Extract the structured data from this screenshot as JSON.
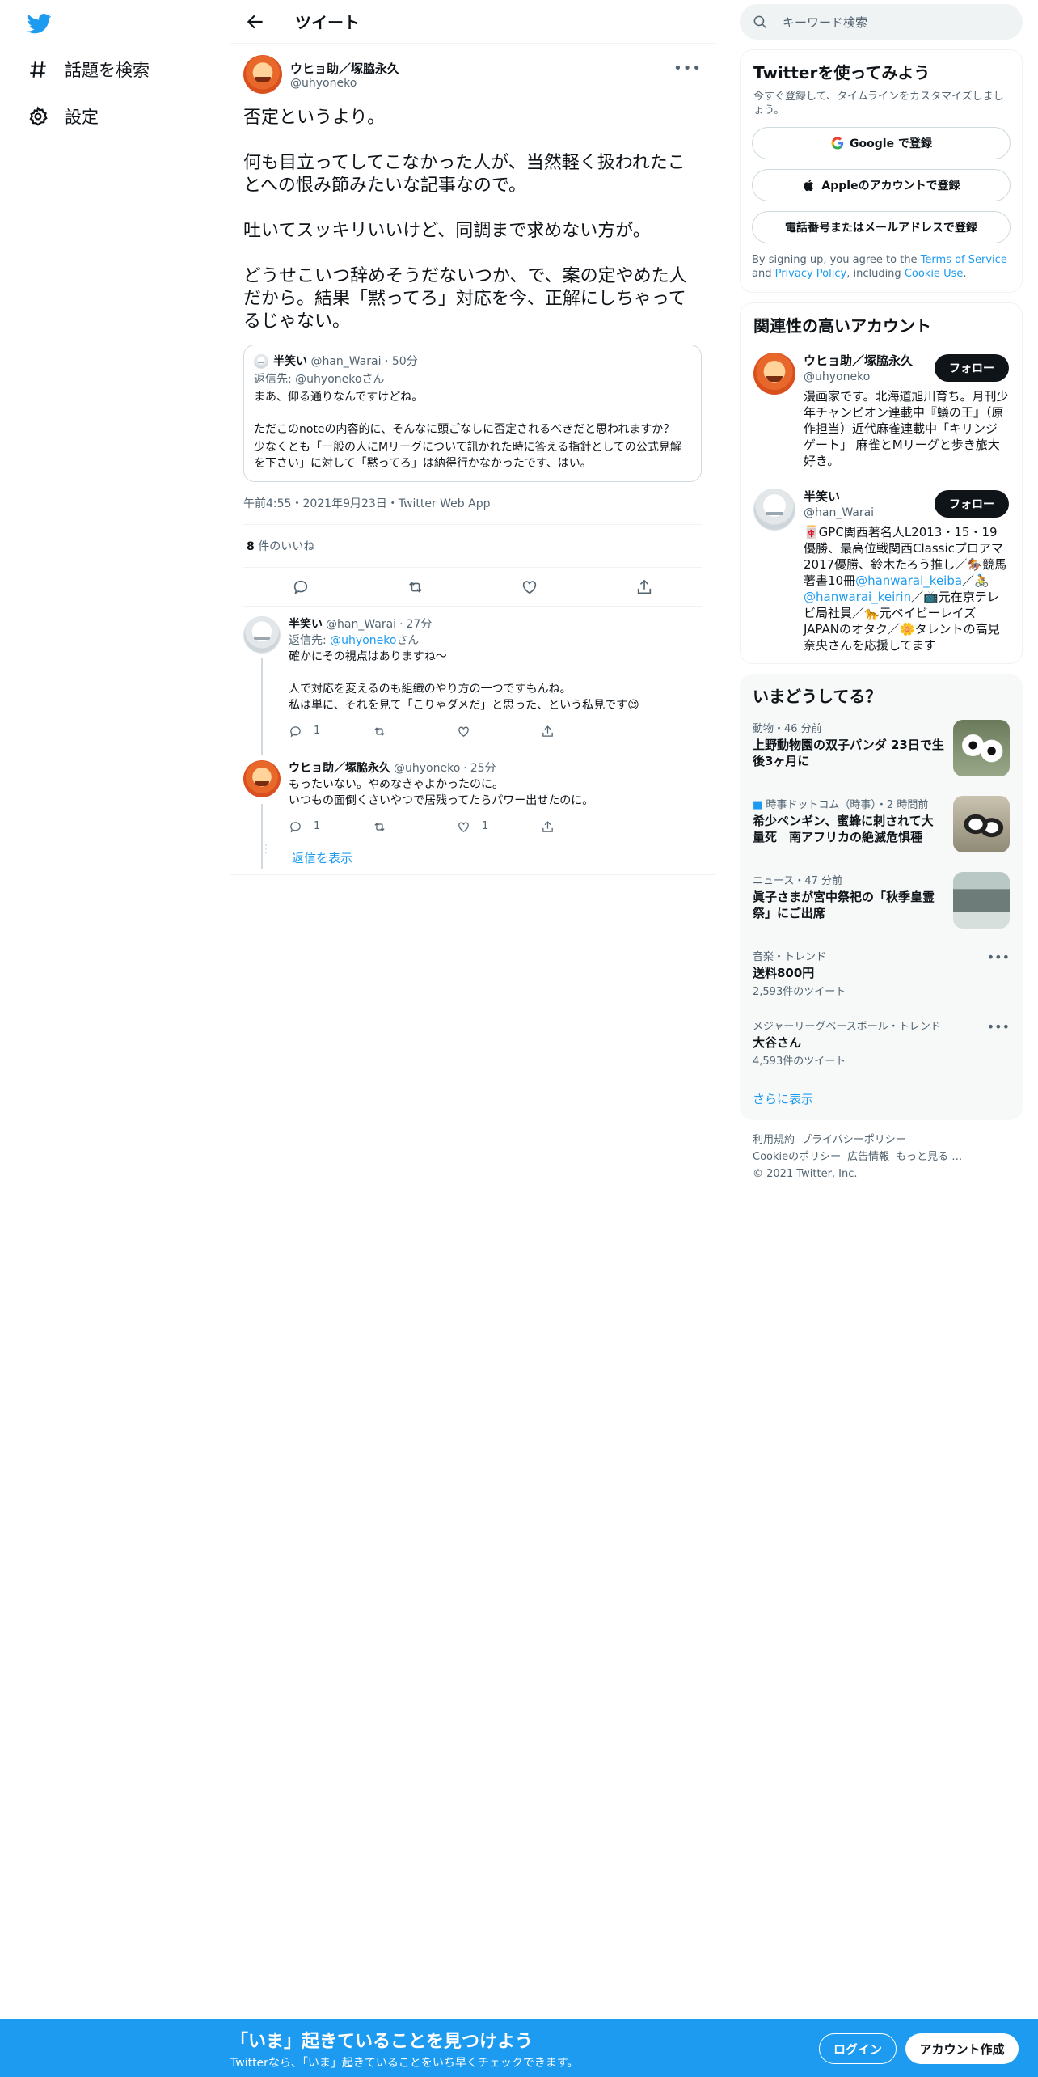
{
  "nav": {
    "explore": "話題を検索",
    "settings": "設定"
  },
  "header": {
    "title": "ツイート"
  },
  "tweet": {
    "author": "ウヒョ助／塚脇永久",
    "handle": "@uhyoneko",
    "paragraphs": [
      "否定というより。",
      "何も目立ってしてこなかった人が、当然軽く扱われたことへの恨み節みたいな記事なので。",
      "吐いてスッキリいいけど、同調まで求めない方が。",
      "どうせこいつ辞めそうだないつか、で、案の定やめた人だから。結果「黙ってろ」対応を今、正解にしちゃってるじゃない。"
    ],
    "quote": {
      "author": "半笑い",
      "handle": "@han_Warai",
      "time": "50分",
      "reply_to_prefix": "返信先: ",
      "reply_to": "@uhyonekoさん",
      "line1": "まあ、仰る通りなんですけどね。",
      "line2": "ただこのnoteの内容的に、そんなに頭ごなしに否定されるべきだと思われますか？",
      "line3": "少なくとも「一般の人にMリーグについて訊かれた時に答える指針としての公式見解を下さい」に対して「黙ってろ」は納得行かなかったです、はい。"
    },
    "meta": "午前4:55・2021年9月23日・Twitter Web App",
    "likes_count": "8",
    "likes_label": " 件のいいね"
  },
  "replies": [
    {
      "author": "半笑い",
      "handle": "@han_Warai",
      "time": "27分",
      "reply_to_prefix": "返信先: ",
      "reply_to": "@uhyoneko",
      "reply_to_suffix": "さん",
      "line1": "確かにその視点はありますね〜",
      "line2": "人で対応を変えるのも組織のやり方の一つですもんね。",
      "line3": "私は単に、それを見て「こりゃダメだ」と思った、という私見です😊",
      "reply_count": "1",
      "retweet_count": "",
      "like_count": ""
    },
    {
      "author": "ウヒョ助／塚脇永久",
      "handle": "@uhyoneko",
      "time": "25分",
      "line1": "もったいない。やめなきゃよかったのに。",
      "line2": "いつもの面倒くさいやつで居残ってたらパワー出せたのに。",
      "reply_count": "1",
      "retweet_count": "",
      "like_count": "1"
    }
  ],
  "show_replies": "返信を表示",
  "search": {
    "placeholder": "キーワード検索"
  },
  "signup": {
    "title": "Twitterを使ってみよう",
    "sub": "今すぐ登録して、タイムラインをカスタマイズしましょう。",
    "google": "Google で登録",
    "apple": "Appleのアカウントで登録",
    "phone": "電話番号またはメールアドレスで登録",
    "terms_1": "By signing up, you agree to the ",
    "terms_link1": "Terms of Service",
    "terms_2": " and ",
    "terms_link2": "Privacy Policy",
    "terms_3": ", including ",
    "terms_link3": "Cookie Use",
    "terms_4": "."
  },
  "related": {
    "title": "関連性の高いアカウント",
    "follow": "フォロー",
    "accounts": [
      {
        "name": "ウヒョ助／塚脇永久",
        "handle": "@uhyoneko",
        "bio": "漫画家です。北海道旭川育ち。月刊少年チャンピオン連載中『蟻の王』（原作担当）近代麻雀連載中「キリンジゲート」 麻雀とMリーグと歩き旅大好き。"
      },
      {
        "name": "半笑い",
        "handle": "@han_Warai",
        "bio_1": "🀄GPC関西著名人L2013・15・19優勝、最高位戦関西Classicプロアマ2017優勝、鈴木たろう推し／🏇競馬著書10冊",
        "bio_link1": "@hanwarai_keiba",
        "bio_2": "／🚴",
        "bio_link2": "@hanwarai_keirin",
        "bio_3": "／📺元在京テレビ局社員／🐆元ベイビーレイズJAPANのオタク／🌼タレントの高見奈央さんを応援してます"
      }
    ]
  },
  "trends": {
    "title": "いまどうしてる？",
    "items": [
      {
        "cat": "動物・46 分前",
        "title": "上野動物園の双子パンダ 23日で生後3ヶ月に",
        "count": "",
        "thumb": "panda"
      },
      {
        "cat": "時事ドットコム（時事）・2 時間前",
        "title": "希少ペンギン、蜜蜂に刺されて大量死　南アフリカの絶滅危惧種",
        "count": "",
        "thumb": "penguin"
      },
      {
        "cat": "ニュース・47 分前",
        "title": "眞子さまが宮中祭祀の「秋季皇霊祭」にご出席",
        "count": "",
        "thumb": "car"
      },
      {
        "cat": "音楽・トレンド",
        "title": "送料800円",
        "count": "2,593件のツイート",
        "thumb": ""
      },
      {
        "cat": "メジャーリーグベースボール・トレンド",
        "title": "大谷さん",
        "count": "4,593件のツイート",
        "thumb": ""
      }
    ],
    "show_more": "さらに表示"
  },
  "footer": {
    "links": [
      "利用規約",
      "プライバシーポリシー",
      "Cookieのポリシー",
      "広告情報",
      "もっと見る …"
    ],
    "copyright": "© 2021 Twitter, Inc."
  },
  "bottom": {
    "headline": "「いま」起きていることを見つけよう",
    "sub": "Twitterなら、「いま」起きていることをいち早くチェックできます。",
    "login": "ログイン",
    "signup": "アカウント作成"
  },
  "colors": {
    "accent": "#1d9bf0",
    "text": "#0f1419",
    "muted": "#536471"
  }
}
